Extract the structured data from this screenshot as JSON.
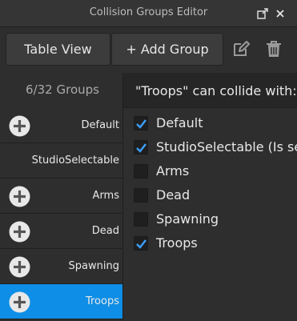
{
  "window": {
    "title": "Collision Groups Editor"
  },
  "toolbar": {
    "table_view_label": "Table View",
    "add_group_label": "+ Add Group"
  },
  "groups_count": "6/32 Groups",
  "groups": [
    {
      "name": "Default",
      "has_add": true,
      "selected": false
    },
    {
      "name": "StudioSelectable",
      "has_add": false,
      "selected": false
    },
    {
      "name": "Arms",
      "has_add": true,
      "selected": false
    },
    {
      "name": "Dead",
      "has_add": true,
      "selected": false
    },
    {
      "name": "Spawning",
      "has_add": true,
      "selected": false
    },
    {
      "name": "Troops",
      "has_add": true,
      "selected": true
    }
  ],
  "panel": {
    "header": "\"Troops\" can collide with:",
    "items": [
      {
        "label": "Default",
        "checked": true
      },
      {
        "label": "StudioSelectable (Is se",
        "checked": true
      },
      {
        "label": "Arms",
        "checked": false
      },
      {
        "label": "Dead",
        "checked": false
      },
      {
        "label": "Spawning",
        "checked": false
      },
      {
        "label": "Troops",
        "checked": true
      }
    ]
  },
  "colors": {
    "selected_row": "#0e8ee6",
    "checkbox_check": "#3aa0ff",
    "background": "#2e2e2e"
  },
  "icons": [
    "undock-icon",
    "close-icon",
    "edit-icon",
    "trash-icon",
    "plus-circle-icon",
    "checkmark-icon"
  ]
}
